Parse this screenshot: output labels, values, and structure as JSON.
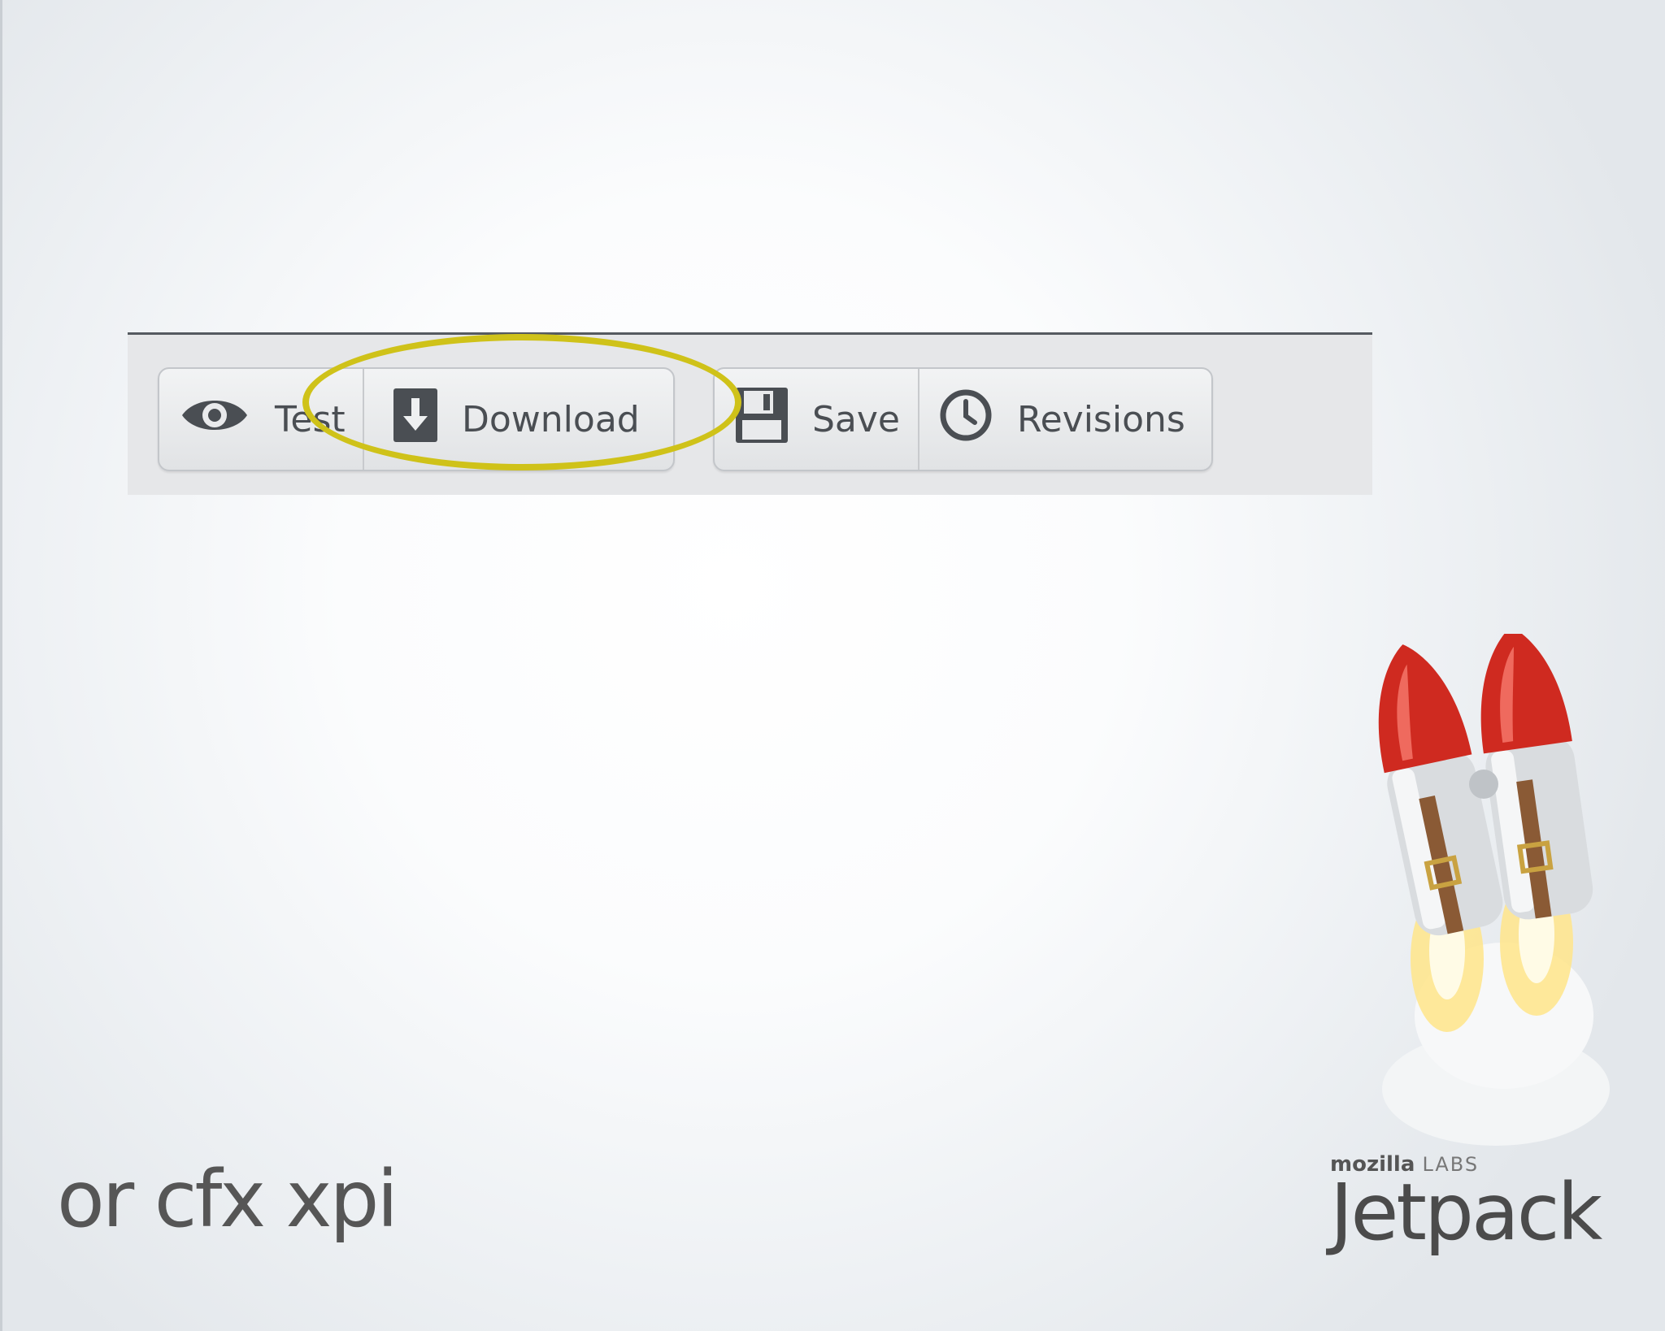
{
  "toolbar": {
    "test_label": "Test",
    "download_label": "Download",
    "save_label": "Save",
    "revisions_label": "Revisions",
    "icons": [
      "eye-icon",
      "download-icon",
      "floppy-disk-icon",
      "clock-icon"
    ]
  },
  "highlight_color": "#cfc219",
  "caption": "or cfx xpi",
  "brand": {
    "org": "mozilla",
    "org_suffix": "LABS",
    "name": "Jetpack"
  }
}
